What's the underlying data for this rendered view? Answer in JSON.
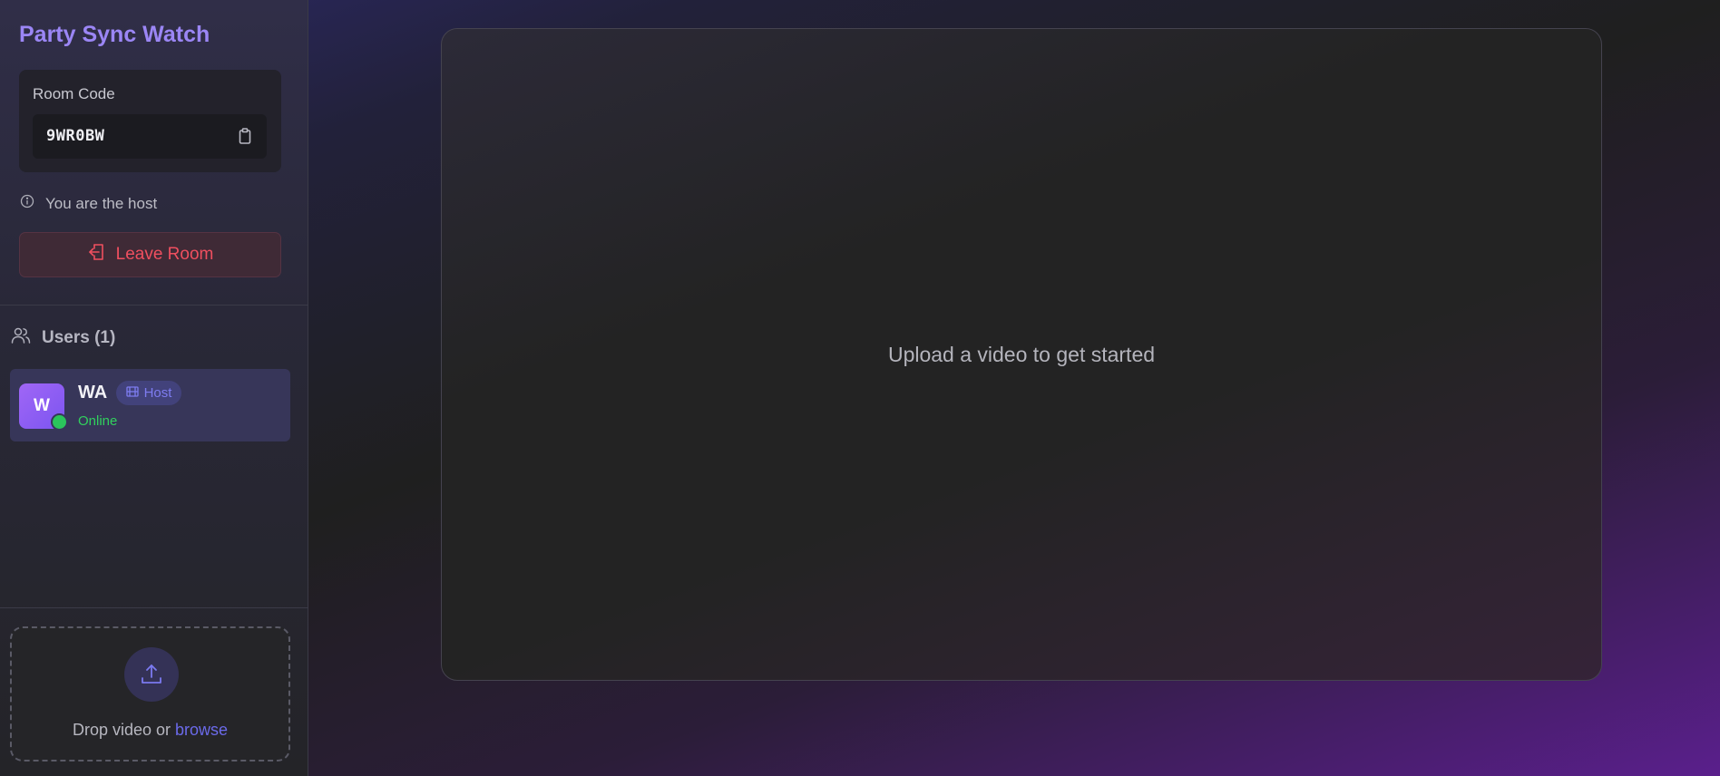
{
  "sidebar": {
    "title": "Party Sync Watch",
    "room": {
      "label": "Room Code",
      "code": "9WR0BW",
      "copy_icon": "clipboard-icon"
    },
    "host_info": {
      "icon": "info-icon",
      "text": "You are the host"
    },
    "leave_button": {
      "icon": "exit-door-icon",
      "label": "Leave Room"
    },
    "users": {
      "icon": "users-icon",
      "header": "Users (1)",
      "list": [
        {
          "avatar_letter": "W",
          "name": "WA",
          "badge": "Host",
          "badge_icon": "film-icon",
          "status": "Online"
        }
      ]
    },
    "upload": {
      "icon": "upload-icon",
      "text": "Drop video or ",
      "link": "browse"
    }
  },
  "main": {
    "placeholder": "Upload a video to get started"
  },
  "colors": {
    "accent": "#9b86f5",
    "danger": "#ef4f5f",
    "online": "#2bc45c",
    "link": "#6b6aea"
  }
}
